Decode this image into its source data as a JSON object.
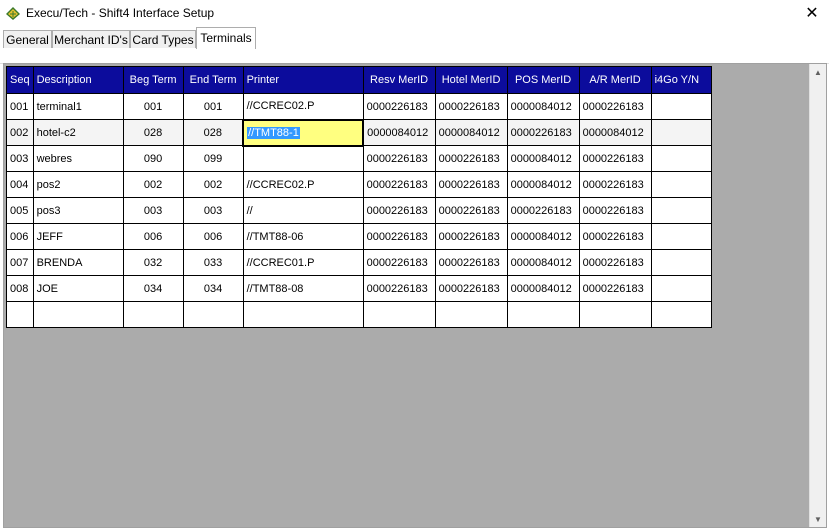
{
  "window": {
    "title": "Execu/Tech - Shift4 Interface Setup",
    "close_glyph": "✕",
    "icon": "app-logo-icon"
  },
  "tabs": [
    {
      "label": "General"
    },
    {
      "label": "Merchant ID's"
    },
    {
      "label": "Card Types"
    },
    {
      "label": "Terminals"
    }
  ],
  "active_tab": "Terminals",
  "grid": {
    "columns": [
      "Seq",
      "Description",
      "Beg Term",
      "End Term",
      "Printer",
      "Resv MerID",
      "Hotel MerID",
      "POS MerID",
      "A/R MerID",
      "i4Go Y/N"
    ],
    "rows": [
      {
        "seq": "001",
        "description": "terminal1",
        "beg": "001",
        "end": "001",
        "printer": "//CCREC02.P",
        "resv": "0000226183",
        "hotel": "0000226183",
        "pos": "0000084012",
        "ar": "0000226183",
        "i4go": ""
      },
      {
        "seq": "002",
        "description": "hotel-c2",
        "beg": "028",
        "end": "028",
        "printer": "//TMT88-1",
        "resv": "0000084012",
        "hotel": "0000084012",
        "pos": "0000226183",
        "ar": "0000084012",
        "i4go": ""
      },
      {
        "seq": "003",
        "description": "webres",
        "beg": "090",
        "end": "099",
        "printer": "",
        "resv": "0000226183",
        "hotel": "0000226183",
        "pos": "0000084012",
        "ar": "0000226183",
        "i4go": ""
      },
      {
        "seq": "004",
        "description": "pos2",
        "beg": "002",
        "end": "002",
        "printer": "//CCREC02.P",
        "resv": "0000226183",
        "hotel": "0000226183",
        "pos": "0000084012",
        "ar": "0000226183",
        "i4go": ""
      },
      {
        "seq": "005",
        "description": "pos3",
        "beg": "003",
        "end": "003",
        "printer": "//",
        "resv": "0000226183",
        "hotel": "0000226183",
        "pos": "0000226183",
        "ar": "0000226183",
        "i4go": ""
      },
      {
        "seq": "006",
        "description": "JEFF",
        "beg": "006",
        "end": "006",
        "printer": "//TMT88-06",
        "resv": "0000226183",
        "hotel": "0000226183",
        "pos": "0000084012",
        "ar": "0000226183",
        "i4go": ""
      },
      {
        "seq": "007",
        "description": "BRENDA",
        "beg": "032",
        "end": "033",
        "printer": "//CCREC01.P",
        "resv": "0000226183",
        "hotel": "0000226183",
        "pos": "0000084012",
        "ar": "0000226183",
        "i4go": ""
      },
      {
        "seq": "008",
        "description": "JOE",
        "beg": "034",
        "end": "034",
        "printer": "//TMT88-08",
        "resv": "0000226183",
        "hotel": "0000226183",
        "pos": "0000084012",
        "ar": "0000226183",
        "i4go": ""
      },
      {
        "seq": "",
        "description": "",
        "beg": "",
        "end": "",
        "printer": "",
        "resv": "",
        "hotel": "",
        "pos": "",
        "ar": "",
        "i4go": ""
      }
    ],
    "selected": {
      "row": 1,
      "field": "printer"
    }
  },
  "colors": {
    "header_bg": "#0c0c9c",
    "selected_cell_bg": "#ffff80",
    "selection_highlight": "#3399ff"
  },
  "scrollbar": {
    "up_glyph": "▲",
    "down_glyph": "▼"
  }
}
